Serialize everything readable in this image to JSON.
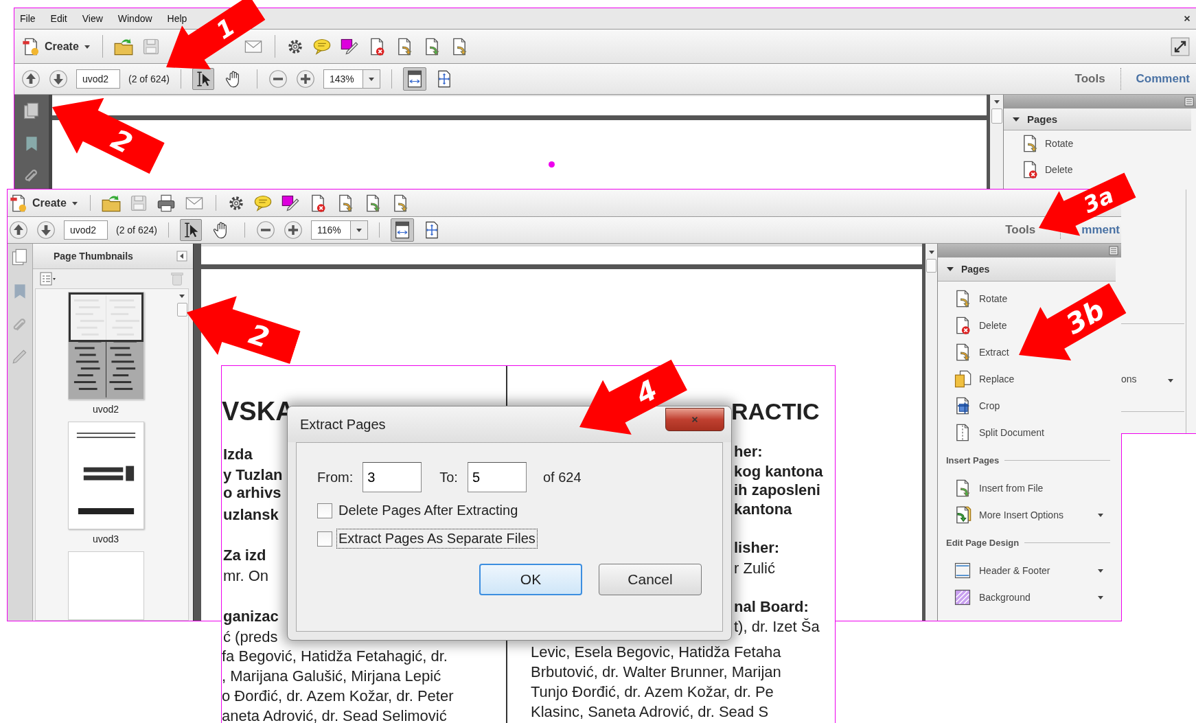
{
  "top_window": {
    "menu": [
      "File",
      "Edit",
      "View",
      "Window",
      "Help"
    ],
    "create": "Create",
    "page_field": "uvod2",
    "page_count": "(2 of 624)",
    "pointer_tools": [
      {
        "selected": true
      },
      {
        "selected": false
      }
    ],
    "zoom": "143%",
    "tabs": [
      "Tools",
      "Comment"
    ],
    "panel": {
      "heading": "Pages",
      "expanded": true,
      "items": [
        "Rotate",
        "Delete"
      ]
    }
  },
  "front_window": {
    "create": "Create",
    "page_field": "uvod2",
    "page_count": "(2 of 624)",
    "pointer_tools": [
      {
        "selected": true
      },
      {
        "selected": false
      }
    ],
    "zoom": "116%",
    "tabs": [
      "Tools",
      "mment"
    ],
    "thumbnails": {
      "title": "Page Thumbnails",
      "pages": [
        {
          "label": "uvod2",
          "selected": true
        },
        {
          "label": "uvod3",
          "selected": false
        }
      ]
    },
    "panel": {
      "sections": [
        {
          "heading": "Pages",
          "expanded": true,
          "items": [
            {
              "label": "Rotate",
              "has_menu": false
            },
            {
              "label": "Delete",
              "has_menu": false
            },
            {
              "label": "Extract",
              "has_menu": false
            },
            {
              "label": "Replace",
              "has_menu": false
            },
            {
              "label": "Crop",
              "has_menu": false
            },
            {
              "label": "Split Document",
              "has_menu": false
            }
          ]
        },
        {
          "heading": "Insert Pages",
          "items": [
            {
              "label": "Insert from File",
              "has_menu": false
            },
            {
              "label": "More Insert Options",
              "has_menu": true
            }
          ]
        },
        {
          "heading": "Edit Page Design",
          "items": [
            {
              "label": "Header & Footer",
              "has_menu": true
            },
            {
              "label": "Background",
              "has_menu": true
            }
          ]
        }
      ]
    }
  },
  "side_fragment": {
    "text": "ons",
    "has_menu": true
  },
  "document_excerpt": {
    "heading_left": "VSKA",
    "heading_right": "RACTIC",
    "left_lines": [
      {
        "text": "Izda",
        "kind": "bold"
      },
      {
        "text": "y Tuzlan",
        "kind": "bold"
      },
      {
        "text": "o arhivs",
        "kind": "bold"
      },
      {
        "text": "uzlansk",
        "kind": "bold"
      },
      {
        "text": "Za izd",
        "kind": "bold"
      },
      {
        "text": "mr. On",
        "kind": "plain"
      },
      {
        "text": "ganizac",
        "kind": "bold"
      },
      {
        "text": "ć (preds",
        "kind": "plain"
      }
    ],
    "right_lines": [
      {
        "text": "her:",
        "kind": "bold"
      },
      {
        "text": "kog kantona",
        "kind": "bold"
      },
      {
        "text": "ih zaposleni",
        "kind": "bold"
      },
      {
        "text": "kantona",
        "kind": "bold"
      },
      {
        "text": "lisher:",
        "kind": "bold"
      },
      {
        "text": "r Zulić",
        "kind": "plain"
      },
      {
        "text": "nal Board:",
        "kind": "bold"
      },
      {
        "text": "t), dr. Izet Ša",
        "kind": "plain"
      }
    ],
    "lower_left": [
      "fa Begović, Hatidža Fetahagić, dr.",
      ", Marijana Galušić, Mirjana Lepić",
      "o Đorđić, dr. Azem Kožar, dr. Peter",
      "aneta Adrović, dr. Sead Selimović"
    ],
    "lower_right": [
      "Levic, Esela Begovic, Hatidža Fetaha",
      "Brbutović, dr. Walter Brunner, Marijan",
      "Tunjo Đorđić, dr. Azem Kožar, dr. Pe",
      "Klasinc, Saneta Adrović, dr. Sead S"
    ]
  },
  "dialog": {
    "title": "Extract Pages",
    "from_label": "From:",
    "from_value": "3",
    "to_label": "To:",
    "to_value": "5",
    "of_text": "of 624",
    "options": [
      {
        "label": "Delete Pages After Extracting",
        "checked": false,
        "focused": false
      },
      {
        "label": "Extract Pages As Separate Files",
        "checked": false,
        "focused": true
      }
    ],
    "buttons": [
      {
        "label": "OK",
        "default": true
      },
      {
        "label": "Cancel",
        "default": false
      }
    ]
  },
  "callouts": [
    {
      "label": "1"
    },
    {
      "label": "2"
    },
    {
      "label": "2"
    },
    {
      "label": "3a"
    },
    {
      "label": "3b"
    },
    {
      "label": "4"
    }
  ]
}
